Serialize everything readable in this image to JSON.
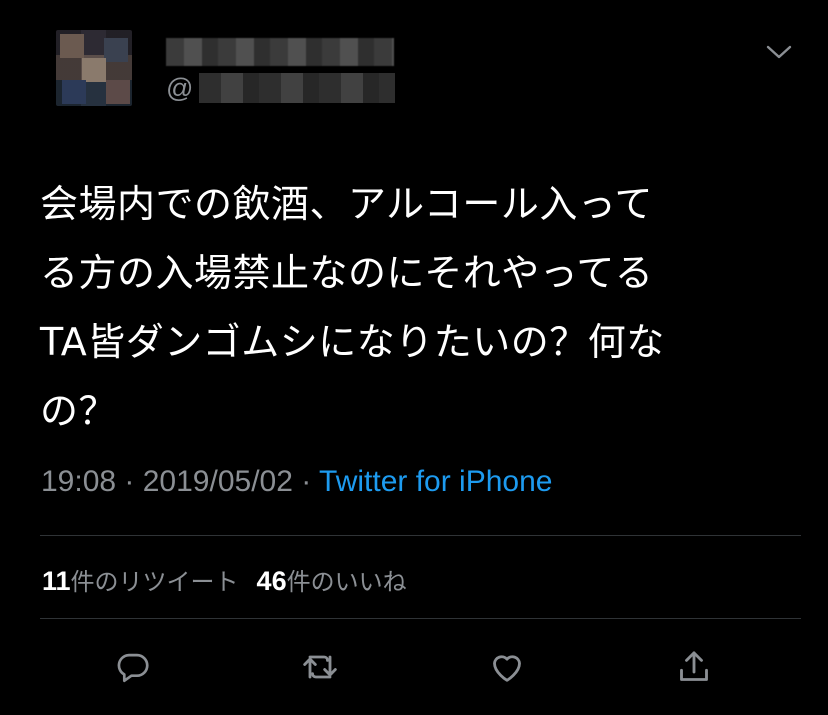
{
  "tweet": {
    "text": "会場内での飲酒、アルコール入って\nる方の入場禁止なのにそれやってる\nTA皆ダンゴムシになりたいの？何な\nの？",
    "handle_prefix": "@",
    "time": "19:08",
    "separator": " · ",
    "date": "2019/05/02",
    "client": "Twitter for iPhone"
  },
  "stats": {
    "retweet_count": "11",
    "retweet_label": "件のリツイート",
    "like_count": "46",
    "like_label": "件のいいね"
  },
  "icons": {
    "menu": "chevron-down-icon",
    "reply": "reply-icon",
    "retweet": "retweet-icon",
    "like": "heart-icon",
    "share": "share-icon"
  },
  "colors": {
    "background": "#000000",
    "text": "#ffffff",
    "secondary": "#8b8f94",
    "link": "#1d9bf0"
  }
}
